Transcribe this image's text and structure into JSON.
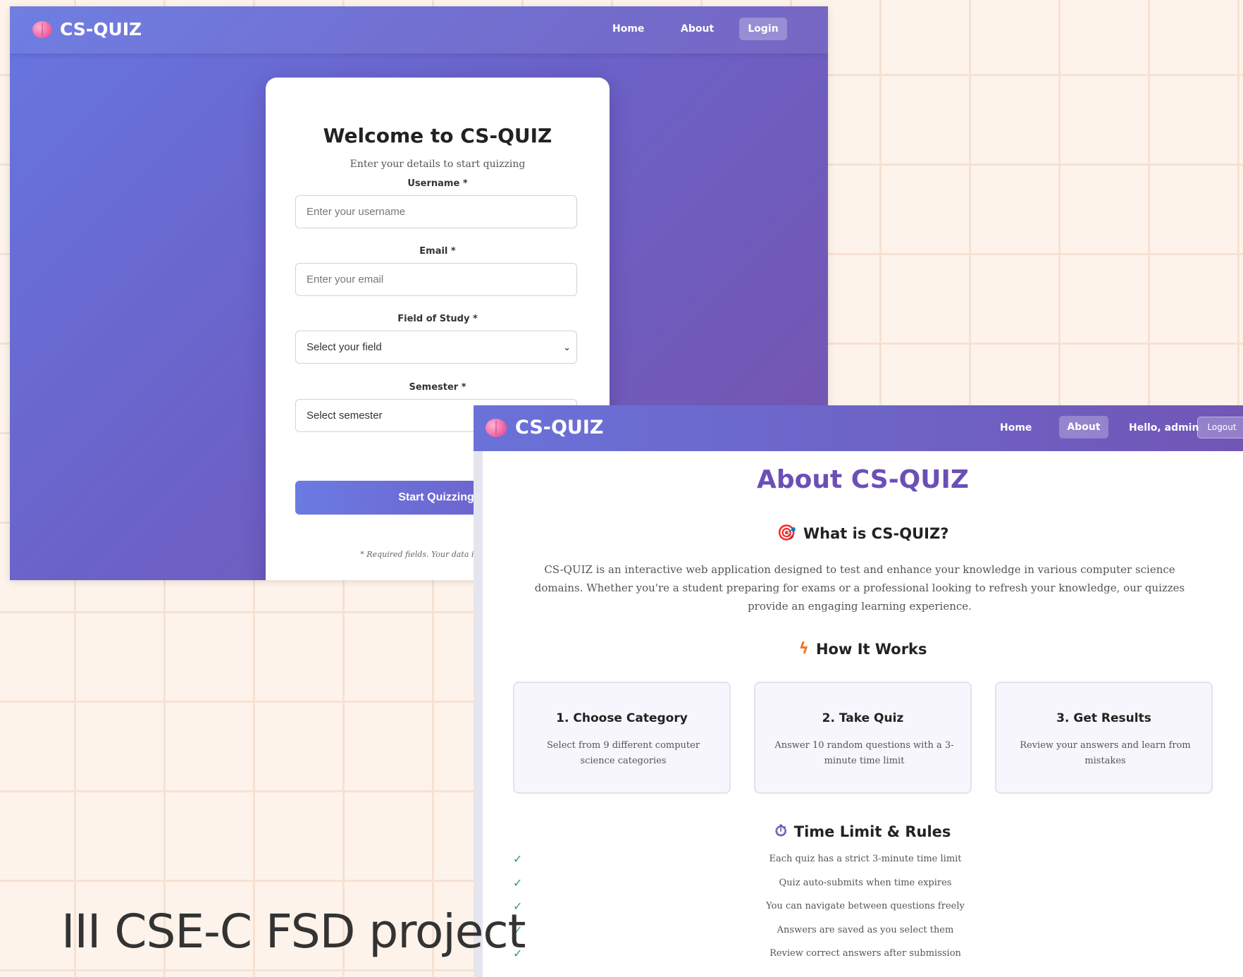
{
  "login_screen": {
    "brand": "CS-QUIZ",
    "nav": {
      "home": "Home",
      "about": "About",
      "login": "Login"
    },
    "title": "Welcome to CS-QUIZ",
    "subtitle": "Enter your details to start quizzing",
    "fields": {
      "username_label": "Username *",
      "username_placeholder": "Enter your username",
      "email_label": "Email *",
      "email_placeholder": "Enter your email",
      "field_label": "Field of Study *",
      "field_value": "Select your field",
      "semester_label": "Semester *",
      "semester_value": "Select semester"
    },
    "submit": "Start Quizzing",
    "note": "* Required fields. Your data is stored lo"
  },
  "about_screen": {
    "brand": "CS-QUIZ",
    "nav": {
      "home": "Home",
      "about": "About",
      "greeting": "Hello, admin",
      "logout": "Logout"
    },
    "title": "About CS-QUIZ",
    "what_heading": "What is CS-QUIZ?",
    "what_text": "CS-QUIZ is an interactive web application designed to test and enhance your knowledge in various computer science domains. Whether you're a student preparing for exams or a professional looking to refresh your knowledge, our quizzes provide an engaging learning experience.",
    "how_heading": "How It Works",
    "steps": [
      {
        "title": "1. Choose Category",
        "desc": "Select from 9 different computer science categories"
      },
      {
        "title": "2. Take Quiz",
        "desc": "Answer 10 random questions with a 3-minute time limit"
      },
      {
        "title": "3. Get Results",
        "desc": "Review your answers and learn from mistakes"
      }
    ],
    "rules_heading": "Time Limit & Rules",
    "check_mark": "✓",
    "rules": [
      "Each quiz has a strict 3-minute time limit",
      "Quiz auto-submits when time expires",
      "You can navigate between questions freely",
      "Answers are saved as you select them",
      "Review correct answers after submission"
    ]
  },
  "caption": "III CSE-C FSD project",
  "colors": {
    "accent": "#6b4fb8",
    "check": "#2f9b4f",
    "grid": "#f6e1d3"
  },
  "icons": {
    "brand": "brain-icon",
    "what": "target-icon",
    "how": "lightning-icon",
    "rules": "stopwatch-icon",
    "select": "chevron-down-icon"
  }
}
